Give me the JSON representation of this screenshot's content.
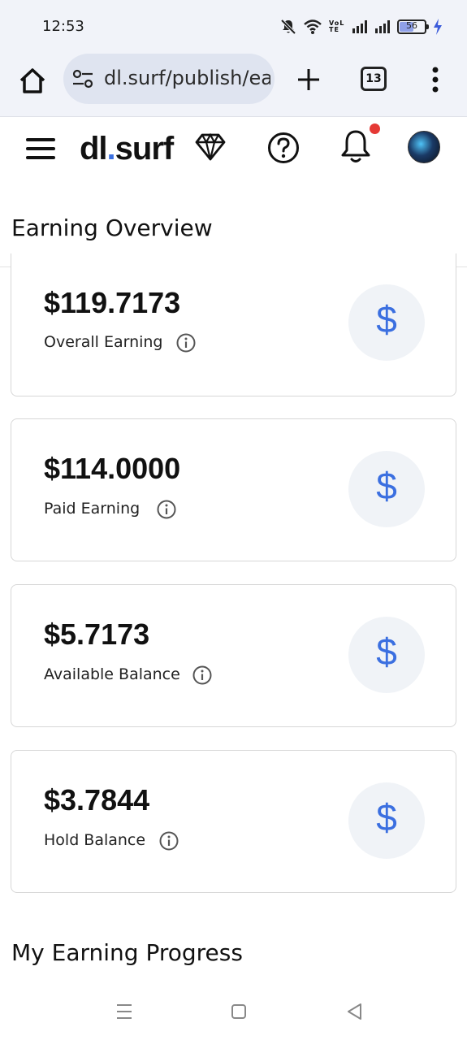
{
  "status_bar": {
    "time": "12:53",
    "network_label": "VoLTE",
    "battery_level": "56",
    "battery_fraction": 0.56,
    "icons": [
      "mute-icon",
      "wifi-icon",
      "signal-icon",
      "signal-icon",
      "battery-icon",
      "charging-icon"
    ]
  },
  "browser": {
    "url": "dl.surf/publish/ea",
    "tab_count": "13",
    "icons": [
      "home-icon",
      "site-settings-icon",
      "new-tab-icon",
      "tabs-icon",
      "more-vert-icon"
    ]
  },
  "header": {
    "logo_main": "dl",
    "logo_dot": ".",
    "logo_tail": "surf",
    "icons": [
      "menu-icon",
      "diamond-icon",
      "help-icon",
      "bell-icon",
      "avatar"
    ],
    "notification_color": "#e53935",
    "accent_color": "#3b6fe0"
  },
  "page": {
    "title": "Earning Overview"
  },
  "cards": [
    {
      "amount": "$119.7173",
      "label": "Overall Earning",
      "symbol": "$"
    },
    {
      "amount": "$114.0000",
      "label": "Paid Earning",
      "symbol": "$"
    },
    {
      "amount": "$5.7173",
      "label": "Available Balance",
      "symbol": "$"
    },
    {
      "amount": "$3.7844",
      "label": "Hold Balance",
      "symbol": "$"
    }
  ],
  "section": {
    "title": "My Earning Progress"
  },
  "nav_bar": {
    "icons": [
      "recents-icon",
      "home-square-icon",
      "back-icon"
    ]
  }
}
